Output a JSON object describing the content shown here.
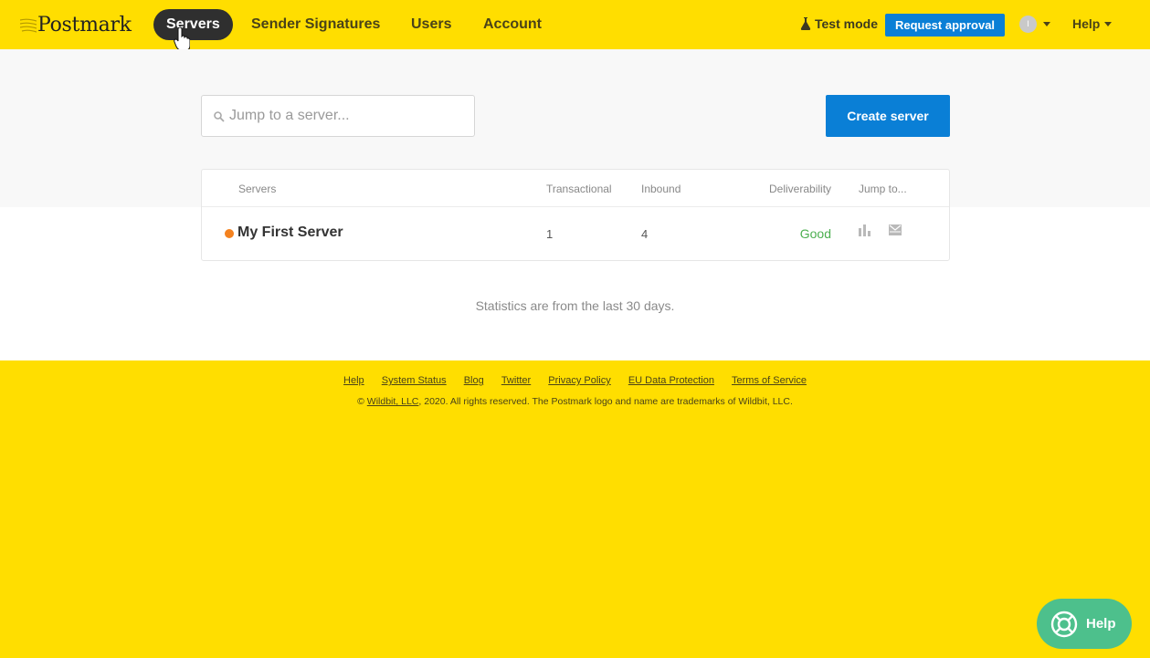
{
  "nav": {
    "logo": "Postmark",
    "items": [
      {
        "label": "Servers",
        "active": true
      },
      {
        "label": "Sender Signatures"
      },
      {
        "label": "Users"
      },
      {
        "label": "Account"
      }
    ],
    "test_mode": "Test mode",
    "request_approval": "Request approval",
    "avatar_initial": "I",
    "help": "Help"
  },
  "search": {
    "placeholder": "Jump to a server..."
  },
  "create_server": "Create server",
  "table": {
    "headers": {
      "servers": "Servers",
      "transactional": "Transactional",
      "inbound": "Inbound",
      "deliverability": "Deliverability",
      "jump": "Jump to..."
    },
    "rows": [
      {
        "name": "My First Server",
        "transactional": "1",
        "inbound": "4",
        "deliverability": "Good",
        "status_color": "#f4821f"
      }
    ]
  },
  "stats_note": "Statistics are from the last 30 days.",
  "footer": {
    "links": [
      "Help",
      "System Status",
      "Blog",
      "Twitter",
      "Privacy Policy",
      "EU Data Protection",
      "Terms of Service"
    ],
    "copyright_prefix": "©",
    "company_link": "Wildbit, LLC",
    "copyright_suffix": ", 2020. All rights reserved. The Postmark logo and name are trademarks of Wildbit, LLC."
  },
  "help_widget": "Help",
  "colors": {
    "brand_yellow": "#ffde00",
    "primary_blue": "#0a7fd6",
    "good_green": "#4caf50",
    "help_green": "#4dc08c"
  }
}
